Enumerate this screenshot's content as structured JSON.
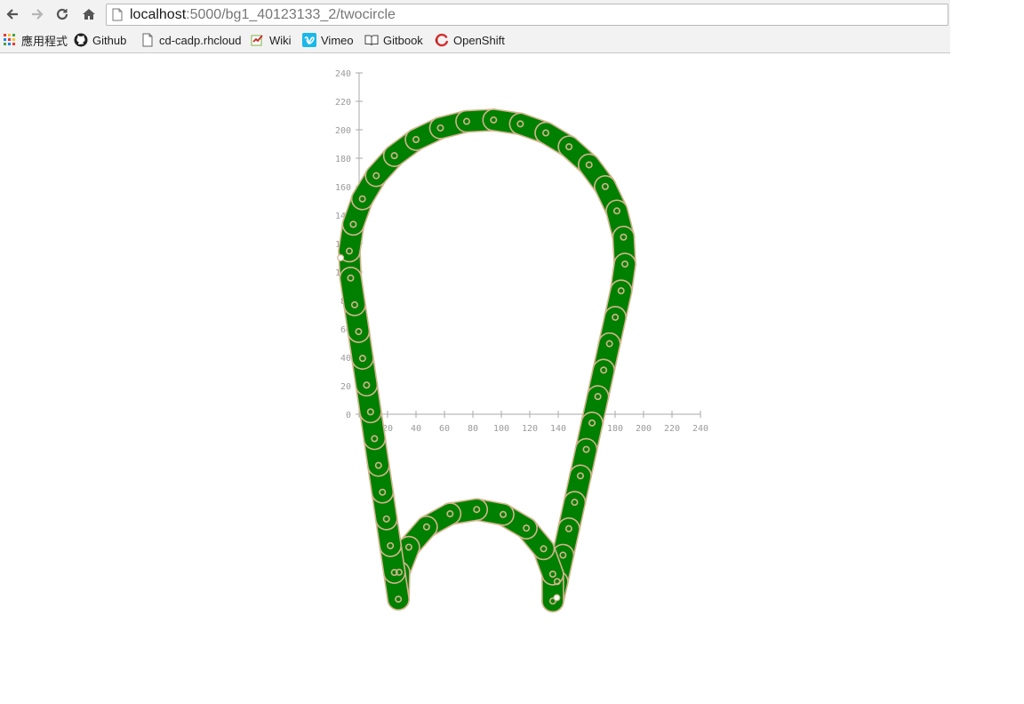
{
  "browser": {
    "url_host": "localhost",
    "url_path": ":5000/bg1_40123133_2/twocircle",
    "bookmarks": [
      {
        "label": "應用程式",
        "icon": "apps-grid-icon"
      },
      {
        "label": "Github",
        "icon": "github-icon"
      },
      {
        "label": "cd-cadp.rhcloud",
        "icon": "page-icon"
      },
      {
        "label": "Wiki",
        "icon": "wiki-icon"
      },
      {
        "label": "Vimeo",
        "icon": "vimeo-icon"
      },
      {
        "label": "Gitbook",
        "icon": "gitbook-icon"
      },
      {
        "label": "OpenShift",
        "icon": "openshift-icon"
      }
    ]
  },
  "colors": {
    "link_fill": "#008000",
    "link_outline": "#d2b48c",
    "axis": "#aaaaaa",
    "tick_text": "#9a9a9a",
    "pin_hole": "#ffffff"
  },
  "chart_data": {
    "type": "diagram",
    "description_free": true,
    "x_ticks": [
      0,
      20,
      40,
      60,
      80,
      100,
      120,
      140,
      160,
      180,
      200,
      220,
      240
    ],
    "y_ticks": [
      0,
      20,
      40,
      60,
      80,
      100,
      120,
      140,
      160,
      180,
      200,
      220,
      240
    ],
    "xlim": [
      0,
      240
    ],
    "ylim": [
      0,
      240
    ],
    "chain": {
      "upper_circle": {
        "cx": 90,
        "cy": 110,
        "r": 97
      },
      "lower_circle": {
        "cx": 82,
        "cy": -122,
        "r": 55
      },
      "link_count": 52,
      "pitch": 20,
      "highlighted_pins": [
        {
          "x": -13,
          "y": 110
        },
        {
          "x": 139,
          "y": -129
        }
      ]
    }
  }
}
